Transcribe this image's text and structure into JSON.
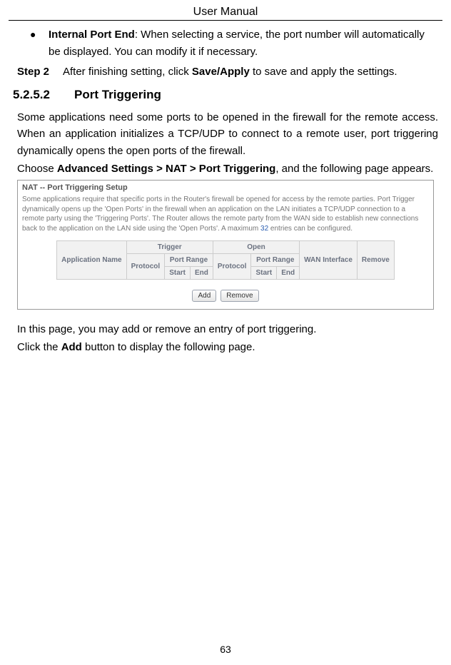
{
  "header": {
    "title": "User Manual"
  },
  "bullet": {
    "label": "Internal Port End",
    "text": ": When selecting a service, the port number will automatically be displayed. You can modify it if necessary."
  },
  "step2": {
    "label": "Step 2",
    "prefix": "After finishing setting, click ",
    "bold": "Save/Apply",
    "suffix": " to save and apply the settings."
  },
  "subheading": {
    "num": "5.2.5.2",
    "title": "Port Triggering"
  },
  "para1": "Some applications need some ports to be opened in the firewall for the remote access. When an application initializes a TCP/UDP to connect to a remote user, port triggering dynamically opens the open ports of the firewall.",
  "para2": {
    "prefix": "Choose ",
    "bold": "Advanced Settings > NAT > Port Triggering",
    "suffix": ", and the following page appears."
  },
  "screenshot": {
    "title": "NAT -- Port Triggering Setup",
    "desc_parts": [
      "Some applications require that specific ports in the Router's firewall be opened for access by the remote parties. Port Trigger dynamically opens up the 'Open Ports' in the firewall when an application on the LAN initiates a TCP/UDP connection to a remote party using the 'Triggering Ports'. The Router allows the remote party from the WAN side to establish new connections back to the application on the LAN side using the 'Open Ports'. A maximum ",
      "32",
      " entries can be configured."
    ],
    "table": {
      "app_name": "Application Name",
      "trigger": "Trigger",
      "open": "Open",
      "protocol": "Protocol",
      "port_range": "Port Range",
      "start": "Start",
      "end": "End",
      "wan": "WAN Interface",
      "remove": "Remove"
    },
    "buttons": {
      "add": "Add",
      "remove": "Remove"
    }
  },
  "para3": "In this page, you may add or remove an entry of port triggering.",
  "para4": {
    "prefix": "Click the ",
    "bold": "Add",
    "suffix": " button to display the following page."
  },
  "page_number": "63"
}
